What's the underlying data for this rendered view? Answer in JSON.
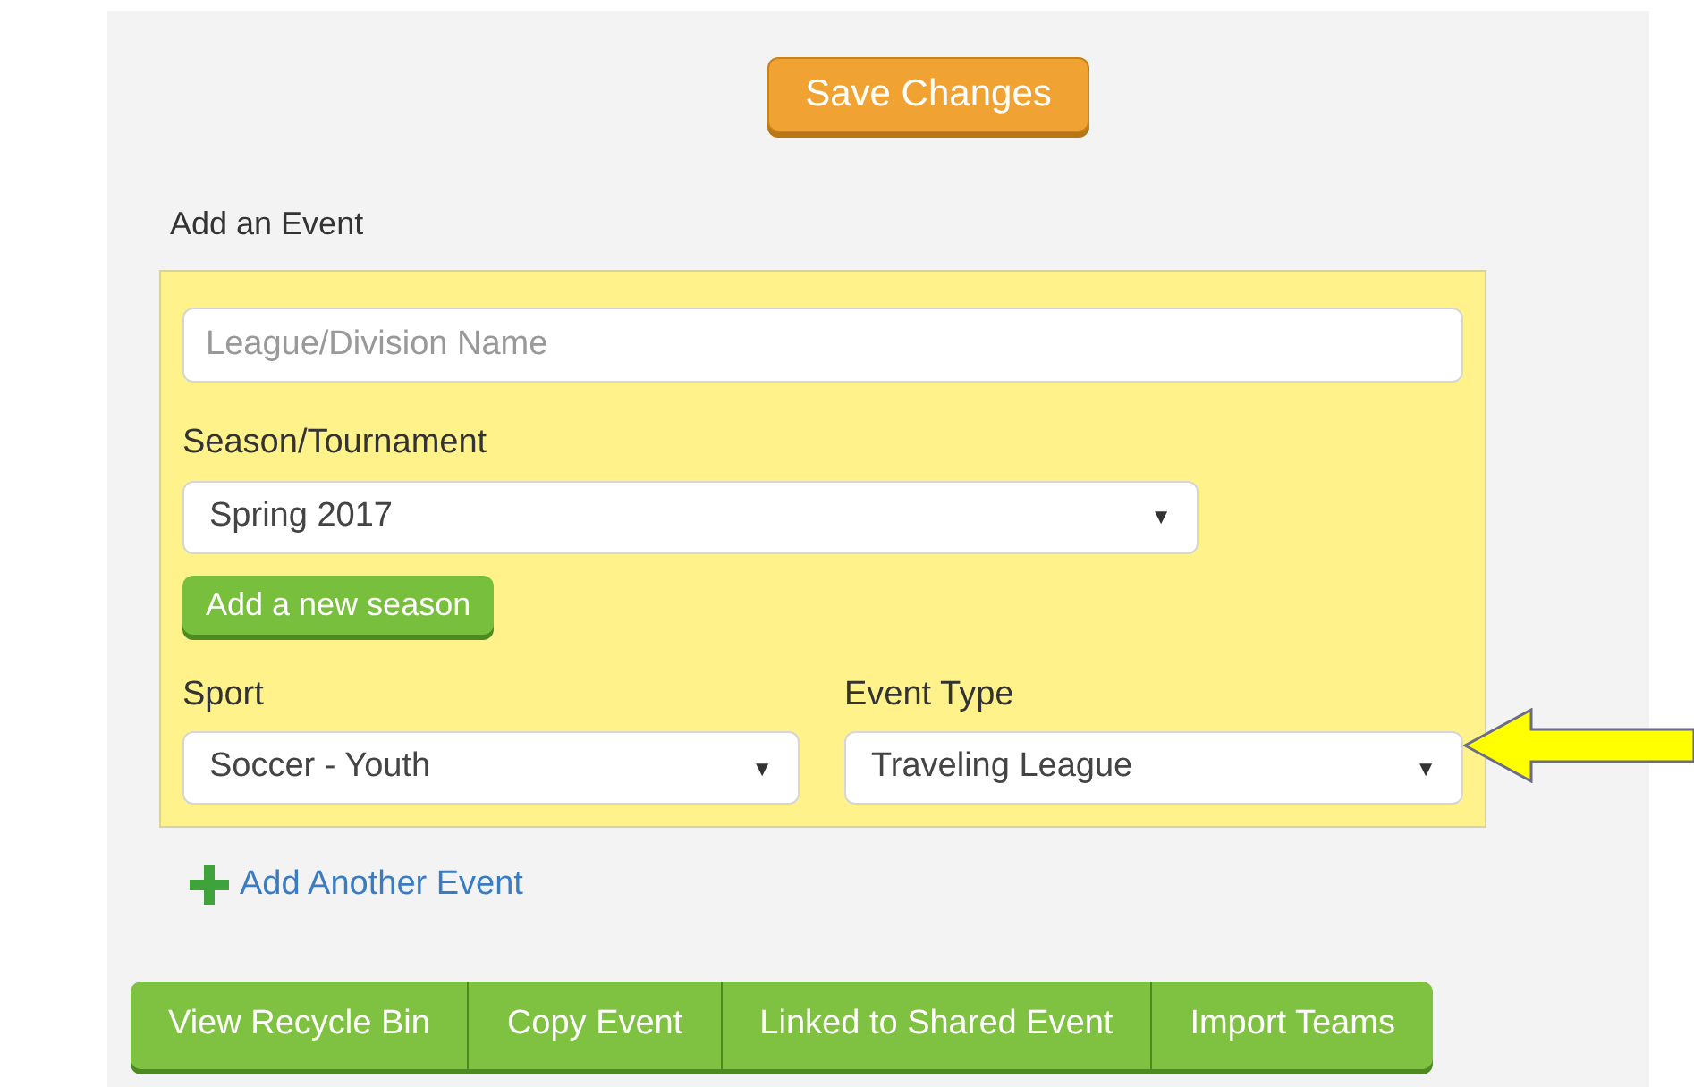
{
  "save_button": "Save Changes",
  "section_title": "Add an Event",
  "event_form": {
    "name_field": {
      "placeholder": "League/Division Name"
    },
    "season": {
      "label": "Season/Tournament",
      "value": "Spring 2017",
      "arrow": "▼"
    },
    "add_season_button": "Add a new season",
    "sport": {
      "label": "Sport",
      "value": "Soccer - Youth",
      "arrow": "▼"
    },
    "event_type": {
      "label": "Event Type",
      "value": "Traveling League",
      "arrow": "▼"
    }
  },
  "add_another_link": "Add Another Event",
  "action_buttons": [
    "View Recycle Bin",
    "Copy Event",
    "Linked to Shared Event",
    "Import Teams"
  ]
}
